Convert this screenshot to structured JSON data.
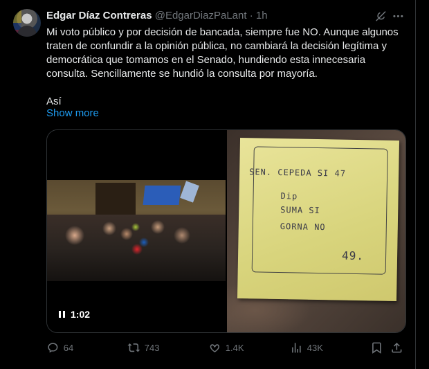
{
  "post": {
    "author_name": "Edgar Díaz Contreras",
    "handle": "@EdgarDiazPaLant",
    "separator": "·",
    "time": "1h",
    "paragraph": "Mi voto público y por decisión de bancada, siempre fue NO. Aunque algunos traten de confundir a la opinión pública, no cambiará la decisión legítima y democrática que tomamos en el Senado, hundiendo esta innecesaria consulta. Sencillamente se hundió la consulta por mayoría.",
    "paragraph2": "Así",
    "show_more": "Show more"
  },
  "media": {
    "video_time": "1:02",
    "note_lines": [
      "SEN. CEPEDA  SI  47",
      "Dip",
      "SUMA   SI",
      "GORNA  NO",
      "49."
    ]
  },
  "actions": {
    "replies": "64",
    "reposts": "743",
    "likes": "1.4K",
    "views": "43K"
  },
  "icons": {
    "grok": "grok-icon",
    "more": "more-icon",
    "reply": "reply-icon",
    "repost": "repost-icon",
    "like": "like-icon",
    "views": "views-icon",
    "bookmark": "bookmark-icon",
    "share": "share-icon",
    "pause": "pause-icon"
  },
  "colors": {
    "background": "#000000",
    "text": "#e7e9ea",
    "secondary": "#71767b",
    "link": "#1d9bf0"
  }
}
